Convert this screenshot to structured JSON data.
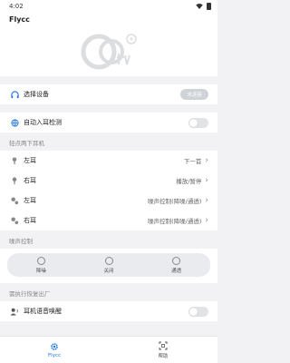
{
  "status": {
    "time": "4:02"
  },
  "app": {
    "title": "Flycc"
  },
  "device": {
    "label": "选择设备",
    "button": "未连接"
  },
  "auto_ear": {
    "label": "自动入耳检测"
  },
  "tap_section": {
    "title": "轻点两下耳机"
  },
  "tap_rows": [
    {
      "label": "左耳",
      "value": "下一首"
    },
    {
      "label": "右耳",
      "value": "播放/暂停"
    },
    {
      "label": "左耳",
      "value": "噪声控制(降噪/通透)"
    },
    {
      "label": "右耳",
      "value": "噪声控制(降噪/通透)"
    }
  ],
  "noise_section": {
    "title": "噪声控制"
  },
  "noise_modes": [
    {
      "label": "降噪"
    },
    {
      "label": "关闭"
    },
    {
      "label": "通透"
    }
  ],
  "background_section": {
    "title": "需执行恢复出厂"
  },
  "voice_wake": {
    "label": "耳机语音唤醒"
  },
  "nav": [
    {
      "label": "Flycc",
      "active": true
    },
    {
      "label": "帮助",
      "active": false
    }
  ],
  "colors": {
    "accent": "#1a73e8",
    "bg": "#f2f2f4"
  }
}
